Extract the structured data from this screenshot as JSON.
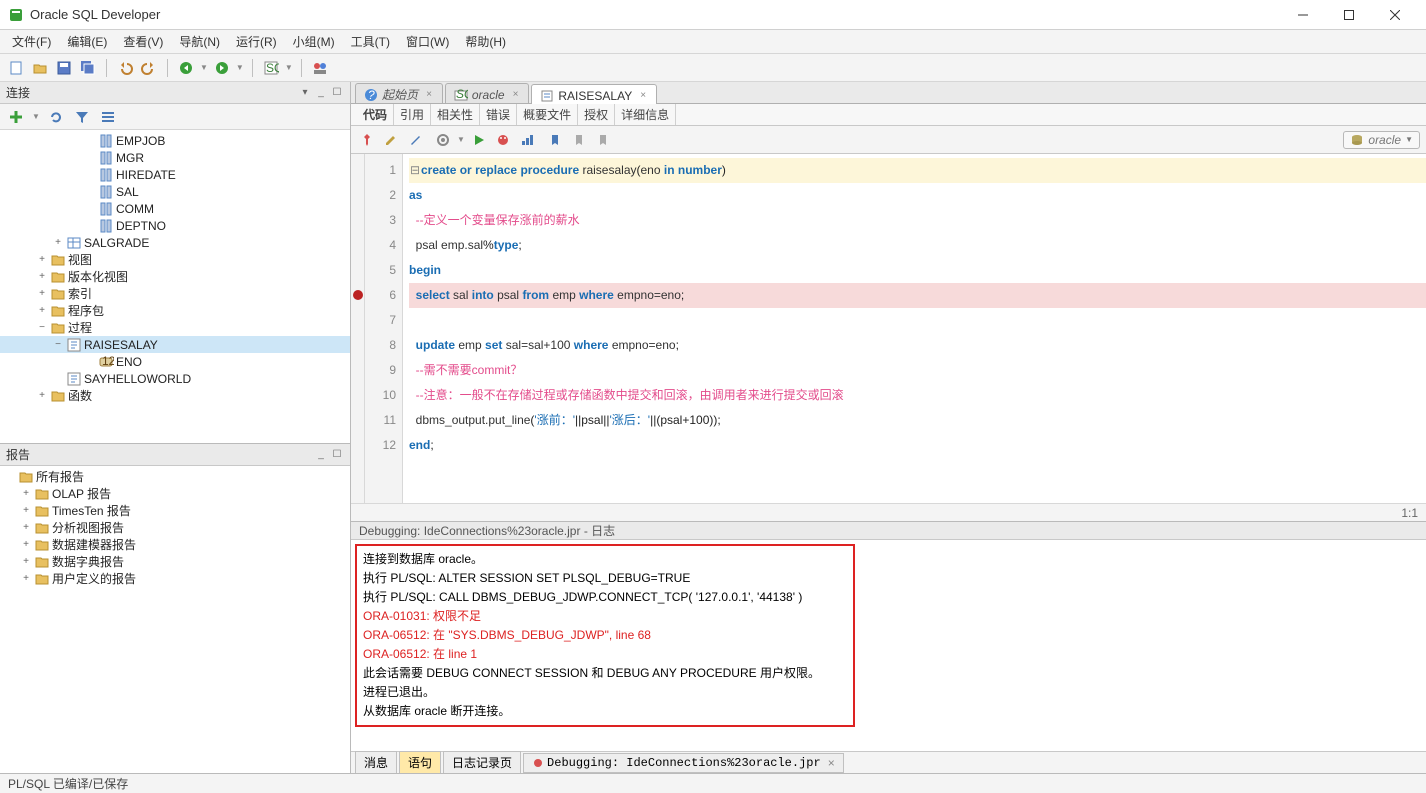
{
  "window": {
    "title": "Oracle SQL Developer"
  },
  "menubar": [
    "文件(F)",
    "编辑(E)",
    "查看(V)",
    "导航(N)",
    "运行(R)",
    "小组(M)",
    "工具(T)",
    "窗口(W)",
    "帮助(H)"
  ],
  "left": {
    "connections_title": "连接",
    "reports_title": "报告",
    "tree": [
      {
        "d": 5,
        "ic": "col",
        "lbl": "EMPJOB"
      },
      {
        "d": 5,
        "ic": "col",
        "lbl": "MGR"
      },
      {
        "d": 5,
        "ic": "col",
        "lbl": "HIREDATE"
      },
      {
        "d": 5,
        "ic": "col",
        "lbl": "SAL"
      },
      {
        "d": 5,
        "ic": "col",
        "lbl": "COMM"
      },
      {
        "d": 5,
        "ic": "col",
        "lbl": "DEPTNO"
      },
      {
        "d": 3,
        "tw": "+",
        "ic": "table",
        "lbl": "SALGRADE"
      },
      {
        "d": 2,
        "tw": "+",
        "ic": "folder",
        "lbl": "视图"
      },
      {
        "d": 2,
        "tw": "+",
        "ic": "folder",
        "lbl": "版本化视图"
      },
      {
        "d": 2,
        "tw": "+",
        "ic": "folder",
        "lbl": "索引"
      },
      {
        "d": 2,
        "tw": "+",
        "ic": "folder",
        "lbl": "程序包"
      },
      {
        "d": 2,
        "tw": "−",
        "ic": "folder",
        "lbl": "过程"
      },
      {
        "d": 3,
        "tw": "−",
        "ic": "proc",
        "lbl": "RAISESALAY",
        "sel": true
      },
      {
        "d": 5,
        "ic": "param",
        "lbl": "ENO"
      },
      {
        "d": 3,
        "tw": "",
        "ic": "proc",
        "lbl": "SAYHELLOWORLD"
      },
      {
        "d": 2,
        "tw": "+",
        "ic": "folder",
        "lbl": "函数"
      }
    ],
    "reports": [
      {
        "d": 0,
        "ic": "folder",
        "lbl": "所有报告"
      },
      {
        "d": 1,
        "tw": "+",
        "ic": "folder",
        "lbl": "OLAP 报告"
      },
      {
        "d": 1,
        "tw": "+",
        "ic": "folder",
        "lbl": "TimesTen 报告"
      },
      {
        "d": 1,
        "tw": "+",
        "ic": "folder",
        "lbl": "分析视图报告"
      },
      {
        "d": 1,
        "tw": "+",
        "ic": "folder",
        "lbl": "数据建模器报告"
      },
      {
        "d": 1,
        "tw": "+",
        "ic": "folder",
        "lbl": "数据字典报告"
      },
      {
        "d": 1,
        "tw": "+",
        "ic": "folder",
        "lbl": "用户定义的报告"
      }
    ]
  },
  "tabs": [
    {
      "label": "起始页",
      "active": false
    },
    {
      "label": "oracle",
      "active": false
    },
    {
      "label": "RAISESALAY",
      "active": true
    }
  ],
  "subtabs": [
    "代码",
    "引用",
    "相关性",
    "错误",
    "概要文件",
    "授权",
    "详细信息"
  ],
  "db_chip": "oracle",
  "code_lines": [
    {
      "n": 1,
      "hl": "y",
      "html": "<span class='fold'>⊟</span><span class='kw'>create</span> <span class='kw'>or</span> <span class='kw'>replace</span> <span class='kw'>procedure</span> <span class='ident'>raisesalay</span>(<span class='ident'>eno</span> <span class='kw'>in</span> <span class='kw'>number</span>)"
    },
    {
      "n": 2,
      "html": "<span class='kw'>as</span>"
    },
    {
      "n": 3,
      "html": "  <span class='cmt'>--定义一个变量保存涨前的薪水</span>"
    },
    {
      "n": 4,
      "html": "  <span class='ident'>psal emp.sal</span>%<span class='kw'>type</span>;"
    },
    {
      "n": 5,
      "html": "<span class='kw'>begin</span>"
    },
    {
      "n": 6,
      "hl": "r",
      "bp": true,
      "html": "  <span class='kw'>select</span> <span class='ident'>sal</span> <span class='kw'>into</span> <span class='ident'>psal</span> <span class='kw'>from</span> <span class='ident'>emp</span> <span class='kw'>where</span> <span class='ident'>empno=eno</span>;"
    },
    {
      "n": 7,
      "html": ""
    },
    {
      "n": 8,
      "html": "  <span class='kw'>update</span> <span class='ident'>emp</span> <span class='kw'>set</span> <span class='ident'>sal=sal+100</span> <span class='kw'>where</span> <span class='ident'>empno=eno</span>;"
    },
    {
      "n": 9,
      "html": "  <span class='cmt'>--需不需要commit？</span>"
    },
    {
      "n": 10,
      "html": "  <span class='cmt'>--注意：一般不在存储过程或存储函数中提交和回滚，由调用者来进行提交或回滚</span>"
    },
    {
      "n": 11,
      "html": "  <span class='ident'>dbms_output.put_line</span>(<span class='str'>'涨前：'</span>||psal||<span class='str'>'涨后：'</span>||(psal+100));"
    },
    {
      "n": 12,
      "html": "<span class='kw'>end</span>;"
    }
  ],
  "cursor_pos": "1:1",
  "log": {
    "header": "Debugging: IdeConnections%23oracle.jpr - 日志",
    "lines": [
      {
        "t": "连接到数据库 oracle。"
      },
      {
        "t": "执行 PL/SQL: ALTER SESSION SET PLSQL_DEBUG=TRUE"
      },
      {
        "t": "执行 PL/SQL: CALL DBMS_DEBUG_JDWP.CONNECT_TCP( '127.0.0.1', '44138' )"
      },
      {
        "t": "ORA-01031: 权限不足",
        "err": true
      },
      {
        "t": "ORA-06512: 在 \"SYS.DBMS_DEBUG_JDWP\", line 68",
        "err": true
      },
      {
        "t": "ORA-06512: 在 line 1",
        "err": true
      },
      {
        "t": "此会话需要 DEBUG CONNECT SESSION 和 DEBUG ANY PROCEDURE 用户权限。"
      },
      {
        "t": "进程已退出。"
      },
      {
        "t": "从数据库 oracle 断开连接。"
      }
    ],
    "tabs": [
      {
        "label": "消息"
      },
      {
        "label": "语句",
        "active": true
      },
      {
        "label": "日志记录页"
      },
      {
        "label": "Debugging: IdeConnections%23oracle.jpr",
        "icon": "bug",
        "close": true
      }
    ]
  },
  "statusbar": "PL/SQL 已编译/已保存"
}
